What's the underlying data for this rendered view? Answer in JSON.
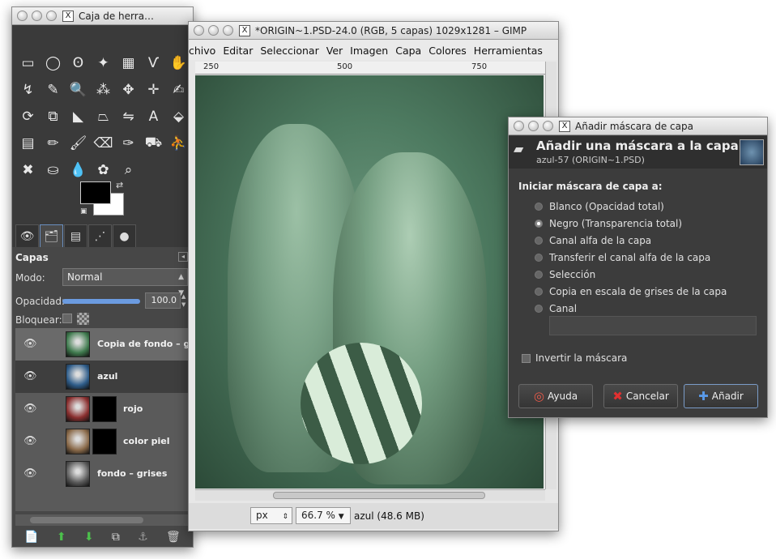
{
  "toolbox": {
    "title": "Caja de herra…",
    "tools": [
      "▭",
      "◯",
      "ʘ",
      "✦",
      "▦",
      "Ѵ",
      "✋",
      "↯",
      "✎",
      "🔍",
      "⁂",
      "✥",
      "✛",
      "✍",
      "⟳",
      "⧉",
      "◣",
      "⏢",
      "⇋",
      "A",
      "⬙",
      "▤",
      "✏",
      "🖌",
      "⌫",
      "✑",
      "⛟",
      "⛹",
      "✖",
      "⛀",
      "💧",
      "✿",
      "⌕",
      "",
      ""
    ],
    "dock_tab_icons": [
      "👁",
      "🗂",
      "▤",
      "⋰",
      "●"
    ],
    "layers_panel": {
      "title": "Capas",
      "mode_label": "Modo:",
      "mode_value": "Normal",
      "opacity_label": "Opacidad:",
      "opacity_value": "100.0",
      "lock_label": "Bloquear:",
      "layers": [
        {
          "name": "Copia de fondo – gr",
          "visible": true,
          "thumb_color": "#3f7a4e",
          "has_mask": false
        },
        {
          "name": "azul",
          "visible": true,
          "thumb_color": "#2f5d8a",
          "has_mask": false
        },
        {
          "name": "rojo",
          "visible": true,
          "thumb_color": "#8a2f2f",
          "has_mask": true
        },
        {
          "name": "color piel",
          "visible": true,
          "thumb_color": "#8a6a4a",
          "has_mask": true
        },
        {
          "name": "fondo – grises",
          "visible": true,
          "thumb_color": "#5a5a5a",
          "has_mask": false
        }
      ],
      "bottom_icons": [
        "📄",
        "⬆",
        "⬇",
        "⧉",
        "⚓",
        "🗑"
      ]
    }
  },
  "image_window": {
    "title": "*ORIGIN~1.PSD-24.0 (RGB, 5 capas) 1029x1281 – GIMP",
    "menu": [
      "chivo",
      "Editar",
      "Seleccionar",
      "Ver",
      "Imagen",
      "Capa",
      "Colores",
      "Herramientas"
    ],
    "ruler_ticks": [
      "250",
      "500",
      "750"
    ],
    "units": "px",
    "zoom": "66.7 %",
    "status": "azul (48.6 MB)"
  },
  "dialog": {
    "title": "Añadir máscara de capa",
    "header_title": "Añadir una máscara a la capa",
    "header_sub": "azul-57 (ORIGIN~1.PSD)",
    "section": "Iniciar máscara de capa a:",
    "options": [
      {
        "label": "Blanco (Opacidad total)",
        "selected": false
      },
      {
        "label": "Negro (Transparencia total)",
        "selected": true
      },
      {
        "label": "Canal alfa de la capa",
        "selected": false
      },
      {
        "label": "Transferir el canal alfa de la capa",
        "selected": false
      },
      {
        "label": "Selección",
        "selected": false
      },
      {
        "label": "Copia en escala de grises de la capa",
        "selected": false
      },
      {
        "label": "Canal",
        "selected": false
      }
    ],
    "invert_label": "Invertir la máscara",
    "buttons": {
      "help": "Ayuda",
      "cancel": "Cancelar",
      "add": "Añadir"
    }
  }
}
